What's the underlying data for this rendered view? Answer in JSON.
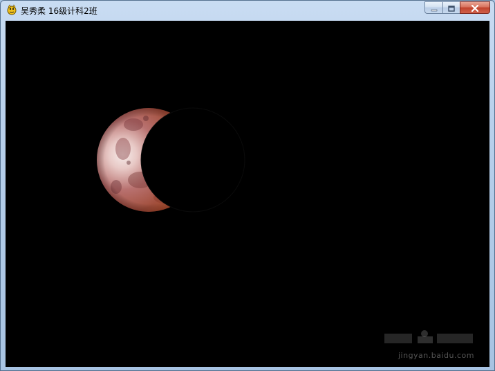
{
  "window": {
    "title": "吴秀柔 16级计科2班",
    "app_icon": "pygame-snake-icon"
  },
  "caption_buttons": {
    "minimize_icon": "minimize-icon",
    "maximize_icon": "maximize-icon",
    "close_icon": "close-icon"
  },
  "canvas": {
    "background_color": "#000000",
    "scene": "lunar-eclipse",
    "moon_colors": [
      "#f3e5e2",
      "#b06a6a",
      "#c1502c",
      "#7a3434"
    ],
    "shadow_color": "#000000",
    "watermark_text": "jingyan.baidu.com"
  }
}
